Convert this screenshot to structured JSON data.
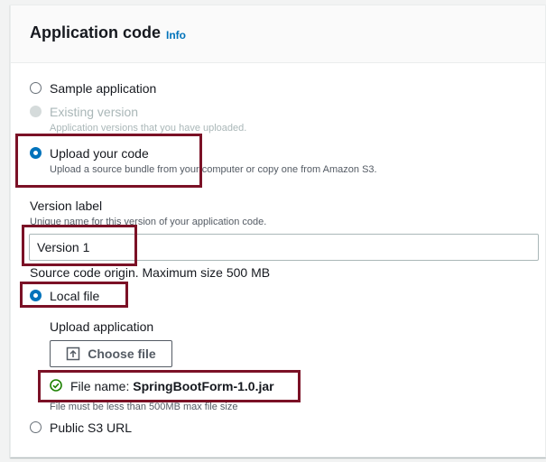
{
  "header": {
    "title": "Application code",
    "info_link": "Info"
  },
  "options": {
    "sample": {
      "label": "Sample application"
    },
    "existing": {
      "label": "Existing version",
      "description": "Application versions that you have uploaded."
    },
    "upload": {
      "label": "Upload your code",
      "description": "Upload a source bundle from your computer or copy one from Amazon S3."
    }
  },
  "version_label": {
    "label": "Version label",
    "description": "Unique name for this version of your application code.",
    "value": "Version 1"
  },
  "source": {
    "label": "Source code origin. Maximum size 500 MB",
    "local": {
      "label": "Local file"
    },
    "upload_app_label": "Upload application",
    "choose_button": "Choose file",
    "file_prefix": "File name:",
    "file_name": "SpringBootForm-1.0.jar",
    "constraint": "File must be less than 500MB max file size",
    "s3": {
      "label": "Public S3 URL"
    }
  },
  "colors": {
    "accent": "#0073bb",
    "success": "#1d8102",
    "highlight": "#7b1126"
  },
  "icons": [
    "upload-icon",
    "success-check-icon"
  ]
}
